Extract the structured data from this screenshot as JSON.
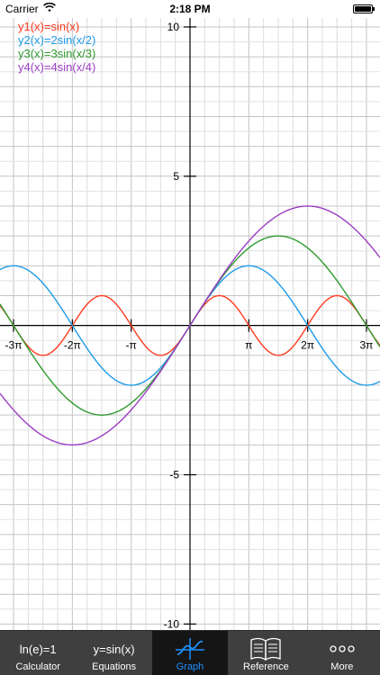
{
  "status_bar": {
    "carrier": "Carrier",
    "time": "2:18 PM",
    "battery_level": 1.0
  },
  "legend": [
    {
      "label": "y1(x)=sin(x)",
      "color": "#ff3b1f"
    },
    {
      "label": "y2(x)=2sin(x/2)",
      "color": "#1e9be8"
    },
    {
      "label": "y3(x)=3sin(x/3)",
      "color": "#2e9a2e"
    },
    {
      "label": "y4(x)=4sin(x/4)",
      "color": "#9b3fc4"
    }
  ],
  "chart_data": {
    "type": "line",
    "series": [
      {
        "name": "y1(x)=sin(x)",
        "function": "sin(x)",
        "color": "#ff3b1f"
      },
      {
        "name": "y2(x)=2sin(x/2)",
        "function": "2*sin(x/2)",
        "color": "#1e9be8"
      },
      {
        "name": "y3(x)=3sin(x/3)",
        "function": "3*sin(x/3)",
        "color": "#2e9a2e"
      },
      {
        "name": "y4(x)=4sin(x/4)",
        "function": "4*sin(x/4)",
        "color": "#9b3fc4"
      }
    ],
    "xlim": [
      -3.23,
      3.23
    ],
    "x_unit": "π",
    "ylim": [
      -10.2,
      10.3
    ],
    "x_ticks": [
      "-3π",
      "-2π",
      "-π",
      "π",
      "2π",
      "3π"
    ],
    "x_tick_values": [
      -3,
      -2,
      -1,
      1,
      2,
      3
    ],
    "y_ticks": [
      "10",
      "5",
      "-5",
      "-10"
    ],
    "y_tick_values": [
      10,
      5,
      -5,
      -10
    ],
    "grid": true
  },
  "tab_bar": {
    "tabs": [
      {
        "id": "calculator",
        "icon_text": "ln(e)=1",
        "label": "Calculator",
        "active": false
      },
      {
        "id": "equations",
        "icon_text": "y=sin(x)",
        "label": "Equations",
        "active": false
      },
      {
        "id": "graph",
        "icon": "graph-icon",
        "label": "Graph",
        "active": true
      },
      {
        "id": "reference",
        "icon": "book-icon",
        "label": "Reference",
        "active": false
      },
      {
        "id": "more",
        "icon": "more-dots-icon",
        "label": "More",
        "active": false
      }
    ]
  }
}
